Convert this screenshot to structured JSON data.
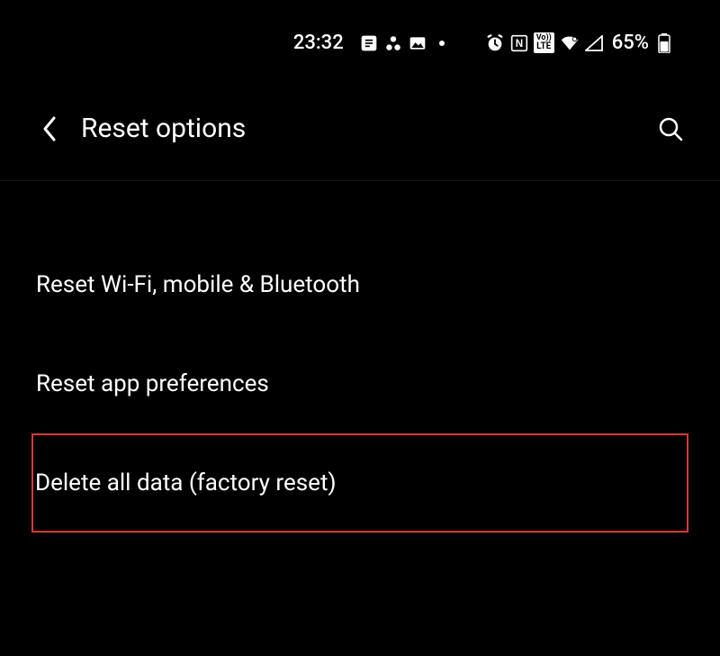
{
  "statusBar": {
    "time": "23:32",
    "batteryPercent": "65%"
  },
  "header": {
    "title": "Reset options"
  },
  "options": {
    "item0": "Reset Wi-Fi, mobile & Bluetooth",
    "item1": "Reset app preferences",
    "item2": "Delete all data (factory reset)"
  }
}
